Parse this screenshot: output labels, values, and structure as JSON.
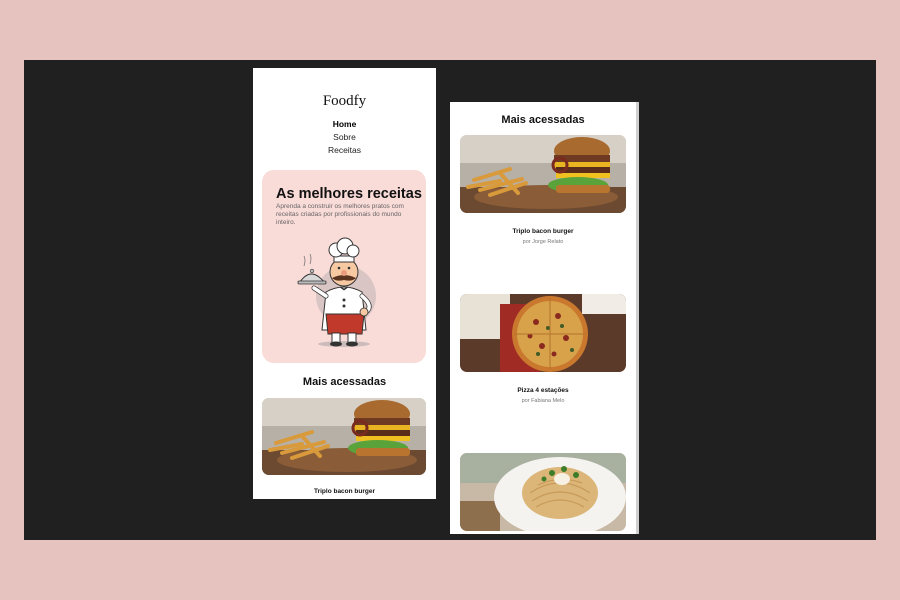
{
  "left_screen": {
    "brand": "Foodfy",
    "nav": [
      {
        "label": "Home",
        "active": true
      },
      {
        "label": "Sobre",
        "active": false
      },
      {
        "label": "Receitas",
        "active": false
      }
    ],
    "hero": {
      "title": "As melhores receitas",
      "description": "Aprenda a construir os melhores pratos com receitas criadas por profissionais do mundo inteiro."
    },
    "section_title": "Mais acessadas",
    "recipes": [
      {
        "title": "Triplo bacon burger",
        "image": "burger-photo"
      }
    ]
  },
  "right_screen": {
    "section_title": "Mais acessadas",
    "recipes": [
      {
        "title": "Triplo bacon burger",
        "author": "por Jorge Relato",
        "image": "burger-photo"
      },
      {
        "title": "Pizza 4 estações",
        "author": "por Fabiana Melo",
        "image": "pizza-photo"
      },
      {
        "title": "",
        "author": "",
        "image": "pasta-photo"
      }
    ]
  },
  "colors": {
    "page_background": "#e6c3bf",
    "stage_background": "#202020",
    "hero_background": "#f9dbd8"
  }
}
